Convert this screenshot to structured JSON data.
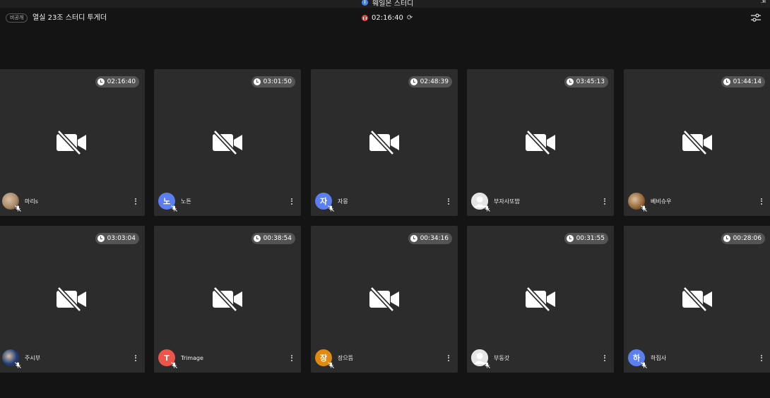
{
  "topbar": {
    "title": "웨일온 스터디",
    "badge": "비공개",
    "room_title": "열실 23조 스터디 투게더",
    "timer": "02:16:40"
  },
  "participants": [
    {
      "name": "마리s",
      "time": "02:16:40",
      "avatar_kind": "photo",
      "avatar_color": "#a88a6a"
    },
    {
      "name": "노튼",
      "time": "03:01:50",
      "avatar_kind": "letter",
      "avatar_letter": "노",
      "avatar_color": "#5b7ff0"
    },
    {
      "name": "자몽",
      "time": "02:48:39",
      "avatar_kind": "letter",
      "avatar_letter": "자",
      "avatar_color": "#5b7ff0"
    },
    {
      "name": "부자사또밥",
      "time": "03:45:13",
      "avatar_kind": "default",
      "avatar_color": "#e5e5e5"
    },
    {
      "name": "베비슈우",
      "time": "01:44:14",
      "avatar_kind": "photo",
      "avatar_color": "#9a6a3a"
    },
    {
      "name": "주시부",
      "time": "03:03:04",
      "avatar_kind": "photo",
      "avatar_color": "#1e3c7a"
    },
    {
      "name": "Trimage",
      "time": "00:38:54",
      "avatar_kind": "letter",
      "avatar_letter": "T",
      "avatar_color": "#ec5548"
    },
    {
      "name": "장으뜸",
      "time": "00:34:16",
      "avatar_kind": "letter",
      "avatar_letter": "장",
      "avatar_color": "#e08a12"
    },
    {
      "name": "부동갓",
      "time": "00:31:55",
      "avatar_kind": "default",
      "avatar_color": "#e5e5e5"
    },
    {
      "name": "하집사",
      "time": "00:28:06",
      "avatar_kind": "letter",
      "avatar_letter": "하",
      "avatar_color": "#5b7ff0"
    }
  ],
  "colors": {
    "background": "#141414",
    "tile": "#2c2c2c",
    "pill": "#545454",
    "accent": "#3d86ff",
    "record": "#e8453c"
  }
}
